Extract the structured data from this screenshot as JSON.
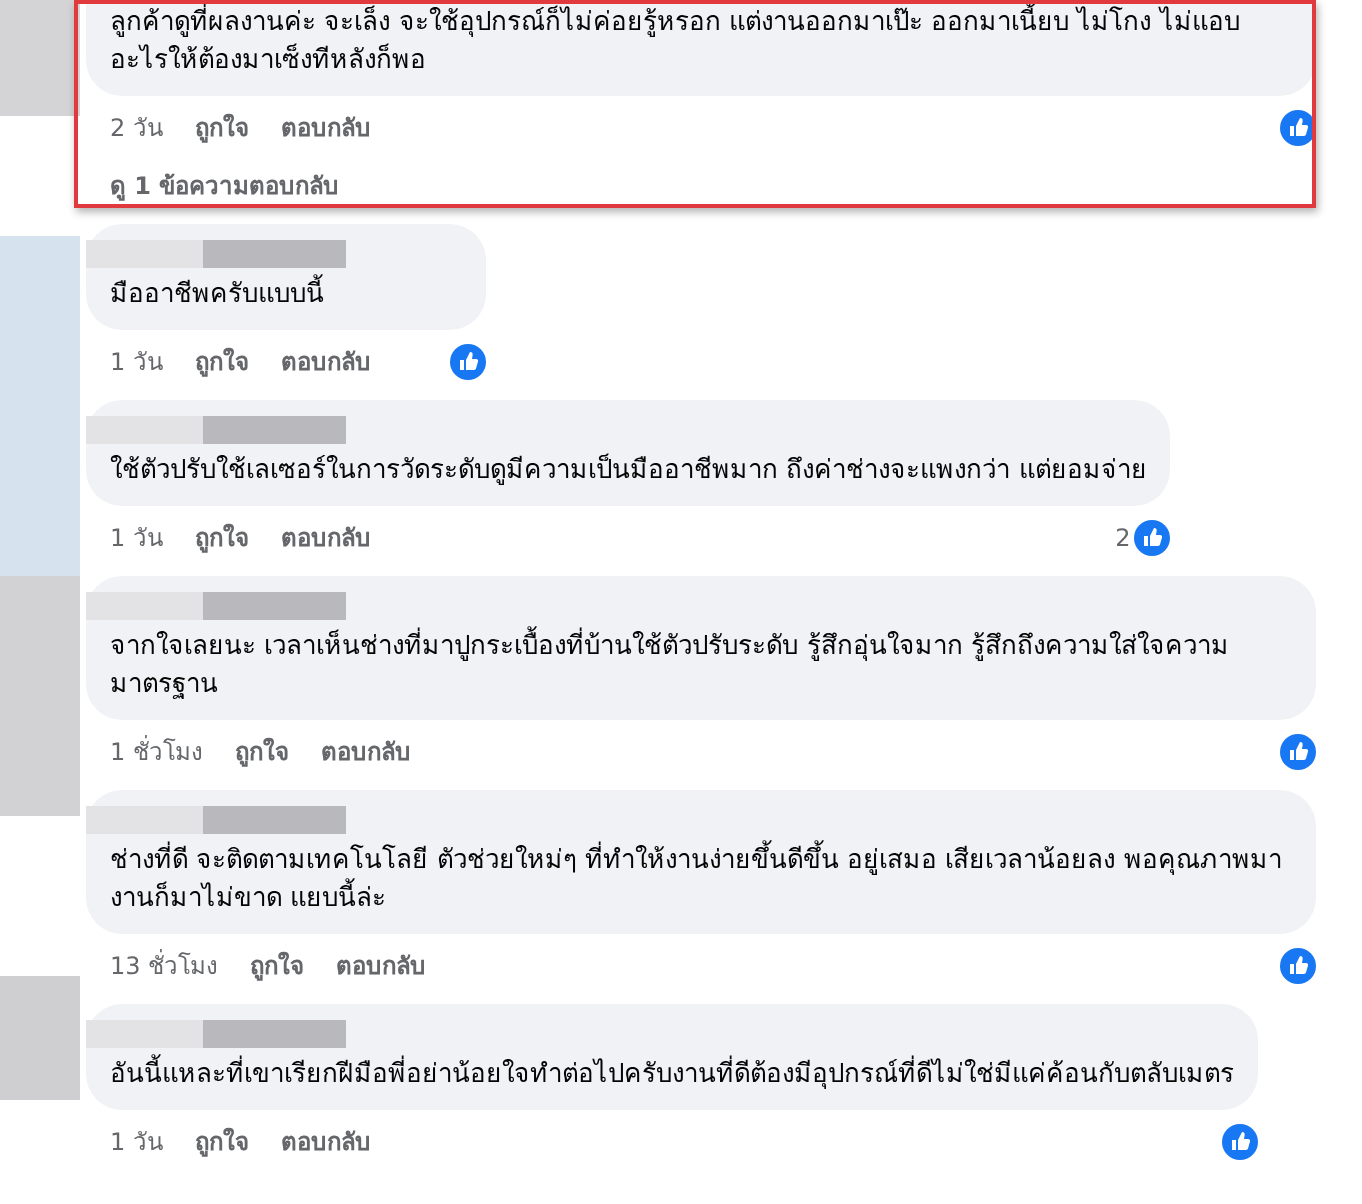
{
  "comments": [
    {
      "highlighted": true,
      "name_hidden": false,
      "text": "ลูกค้าดูที่ผลงานค่ะ จะเล็ง จะใช้อุปกรณ์ก็ไม่ค่อยรู้หรอก แต่งานออกมาเป๊ะ ออกมาเนี้ยบ ไม่โกง ไม่แอบอะไรให้ต้องมาเซ็งทีหลังก็พอ",
      "time": "2 วัน",
      "like_label": "ถูกใจ",
      "reply_label": "ตอบกลับ",
      "view_replies": "ดู 1 ข้อความตอบกลับ"
    },
    {
      "highlighted": false,
      "name_hidden": true,
      "text": "มืออาชีพครับแบบนี้",
      "time": "1 วัน",
      "like_label": "ถูกใจ",
      "reply_label": "ตอบกลับ"
    },
    {
      "highlighted": false,
      "name_hidden": true,
      "text": "ใช้ตัวปรับใช้เลเซอร์ในการวัดระดับดูมีความเป็นมืออาชีพมาก ถึงค่าช่างจะแพงกว่า แต่ยอมจ่าย",
      "time": "1 วัน",
      "like_label": "ถูกใจ",
      "reply_label": "ตอบกลับ",
      "reaction_count": "2"
    },
    {
      "highlighted": false,
      "name_hidden": true,
      "text": "จากใจเลยนะ เวลาเห็นช่างที่มาปูกระเบื้องที่บ้านใช้ตัวปรับระดับ รู้สึกอุ่นใจมาก รู้สึกถึงความใส่ใจความมาตรฐาน",
      "time": "1 ชั่วโมง",
      "like_label": "ถูกใจ",
      "reply_label": "ตอบกลับ"
    },
    {
      "highlighted": false,
      "name_hidden": true,
      "text": "ช่างที่ดี จะติดตามเทคโนโลยี ตัวช่วยใหม่ๆ ที่ทำให้งานง่ายขึ้นดีขึ้น อยู่เสมอ เสียเวลาน้อยลง พอคุณภาพมา งานก็มาไม่ขาด แยบนี้ล่ะ",
      "time": "13 ชั่วโมง",
      "like_label": "ถูกใจ",
      "reply_label": "ตอบกลับ"
    },
    {
      "highlighted": false,
      "name_hidden": true,
      "text": "อันนี้แหละที่เขาเรียกฝีมือพี่อย่าน้อยใจทำต่อไปครับงานที่ดีต้องมีอุปกรณ์ที่ดีไม่ใช่มีแค่ค้อนกับตลับเมตร",
      "time": "1 วัน",
      "like_label": "ถูกใจ",
      "reply_label": "ตอบกลับ"
    }
  ]
}
